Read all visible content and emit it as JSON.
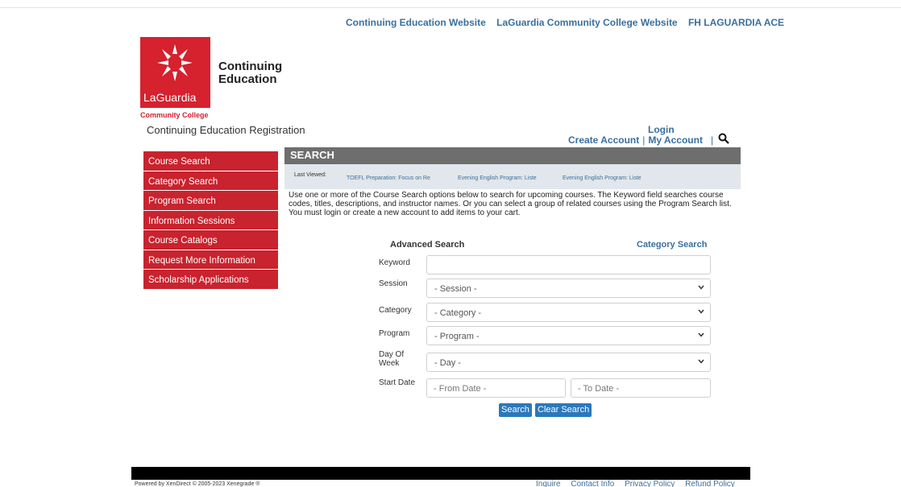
{
  "top_links": [
    "Continuing Education Website",
    "LaGuardia Community College Website",
    "FH LAGUARDIA ACE"
  ],
  "logo": {
    "word": "LaGuardia",
    "sub": "Community College",
    "title_line1": "Continuing",
    "title_line2": "Education",
    "brand_color": "#d6212f"
  },
  "site_title": "Continuing Education Registration",
  "account": {
    "login": "Login",
    "create": "Create Account",
    "my_account": "My Account",
    "sep": "|",
    "search_icon": "magnifier-icon"
  },
  "sidebar": {
    "items": [
      {
        "label": "Course Search"
      },
      {
        "label": "Category Search"
      },
      {
        "label": "Program Search"
      },
      {
        "label": "Information Sessions"
      },
      {
        "label": "Course Catalogs"
      },
      {
        "label": "Request More Information"
      },
      {
        "label": "Scholarship Applications"
      }
    ]
  },
  "search": {
    "header": "SEARCH",
    "last_viewed_label": "Last Viewed:",
    "last_viewed": [
      "TOEFL Preparation: Focus on Re",
      "Evening English Program: Liste",
      "Evening English Program: Liste"
    ],
    "intro": "Use one or more of the Course Search options below to search for upcoming courses. The Keyword field searches course codes, titles, descriptions, and instructor names. Or you can select a group of related courses using the Program Search list. You must login or create a new account to add items to your cart."
  },
  "form": {
    "title": "Advanced Search",
    "category_link": "Category Search",
    "keyword_label": "Keyword",
    "keyword_value": "",
    "session_label": "Session",
    "session_value": "- Session -",
    "category_label": "Category",
    "category_value": "- Category -",
    "program_label": "Program",
    "program_value": "- Program -",
    "day_label_1": "Day Of",
    "day_label_2": "Week",
    "day_value": "- Day -",
    "start_label": "Start Date",
    "from_placeholder": "- From Date -",
    "to_placeholder": "- To Date -",
    "search_button": "Search",
    "clear_button": "Clear Search"
  },
  "footer": {
    "powered": "Powered by XenDirect © 2005-2023 Xenegrade ®",
    "links": [
      "Inquire",
      "Contact Info",
      "Privacy Policy",
      "Refund Policy"
    ]
  }
}
